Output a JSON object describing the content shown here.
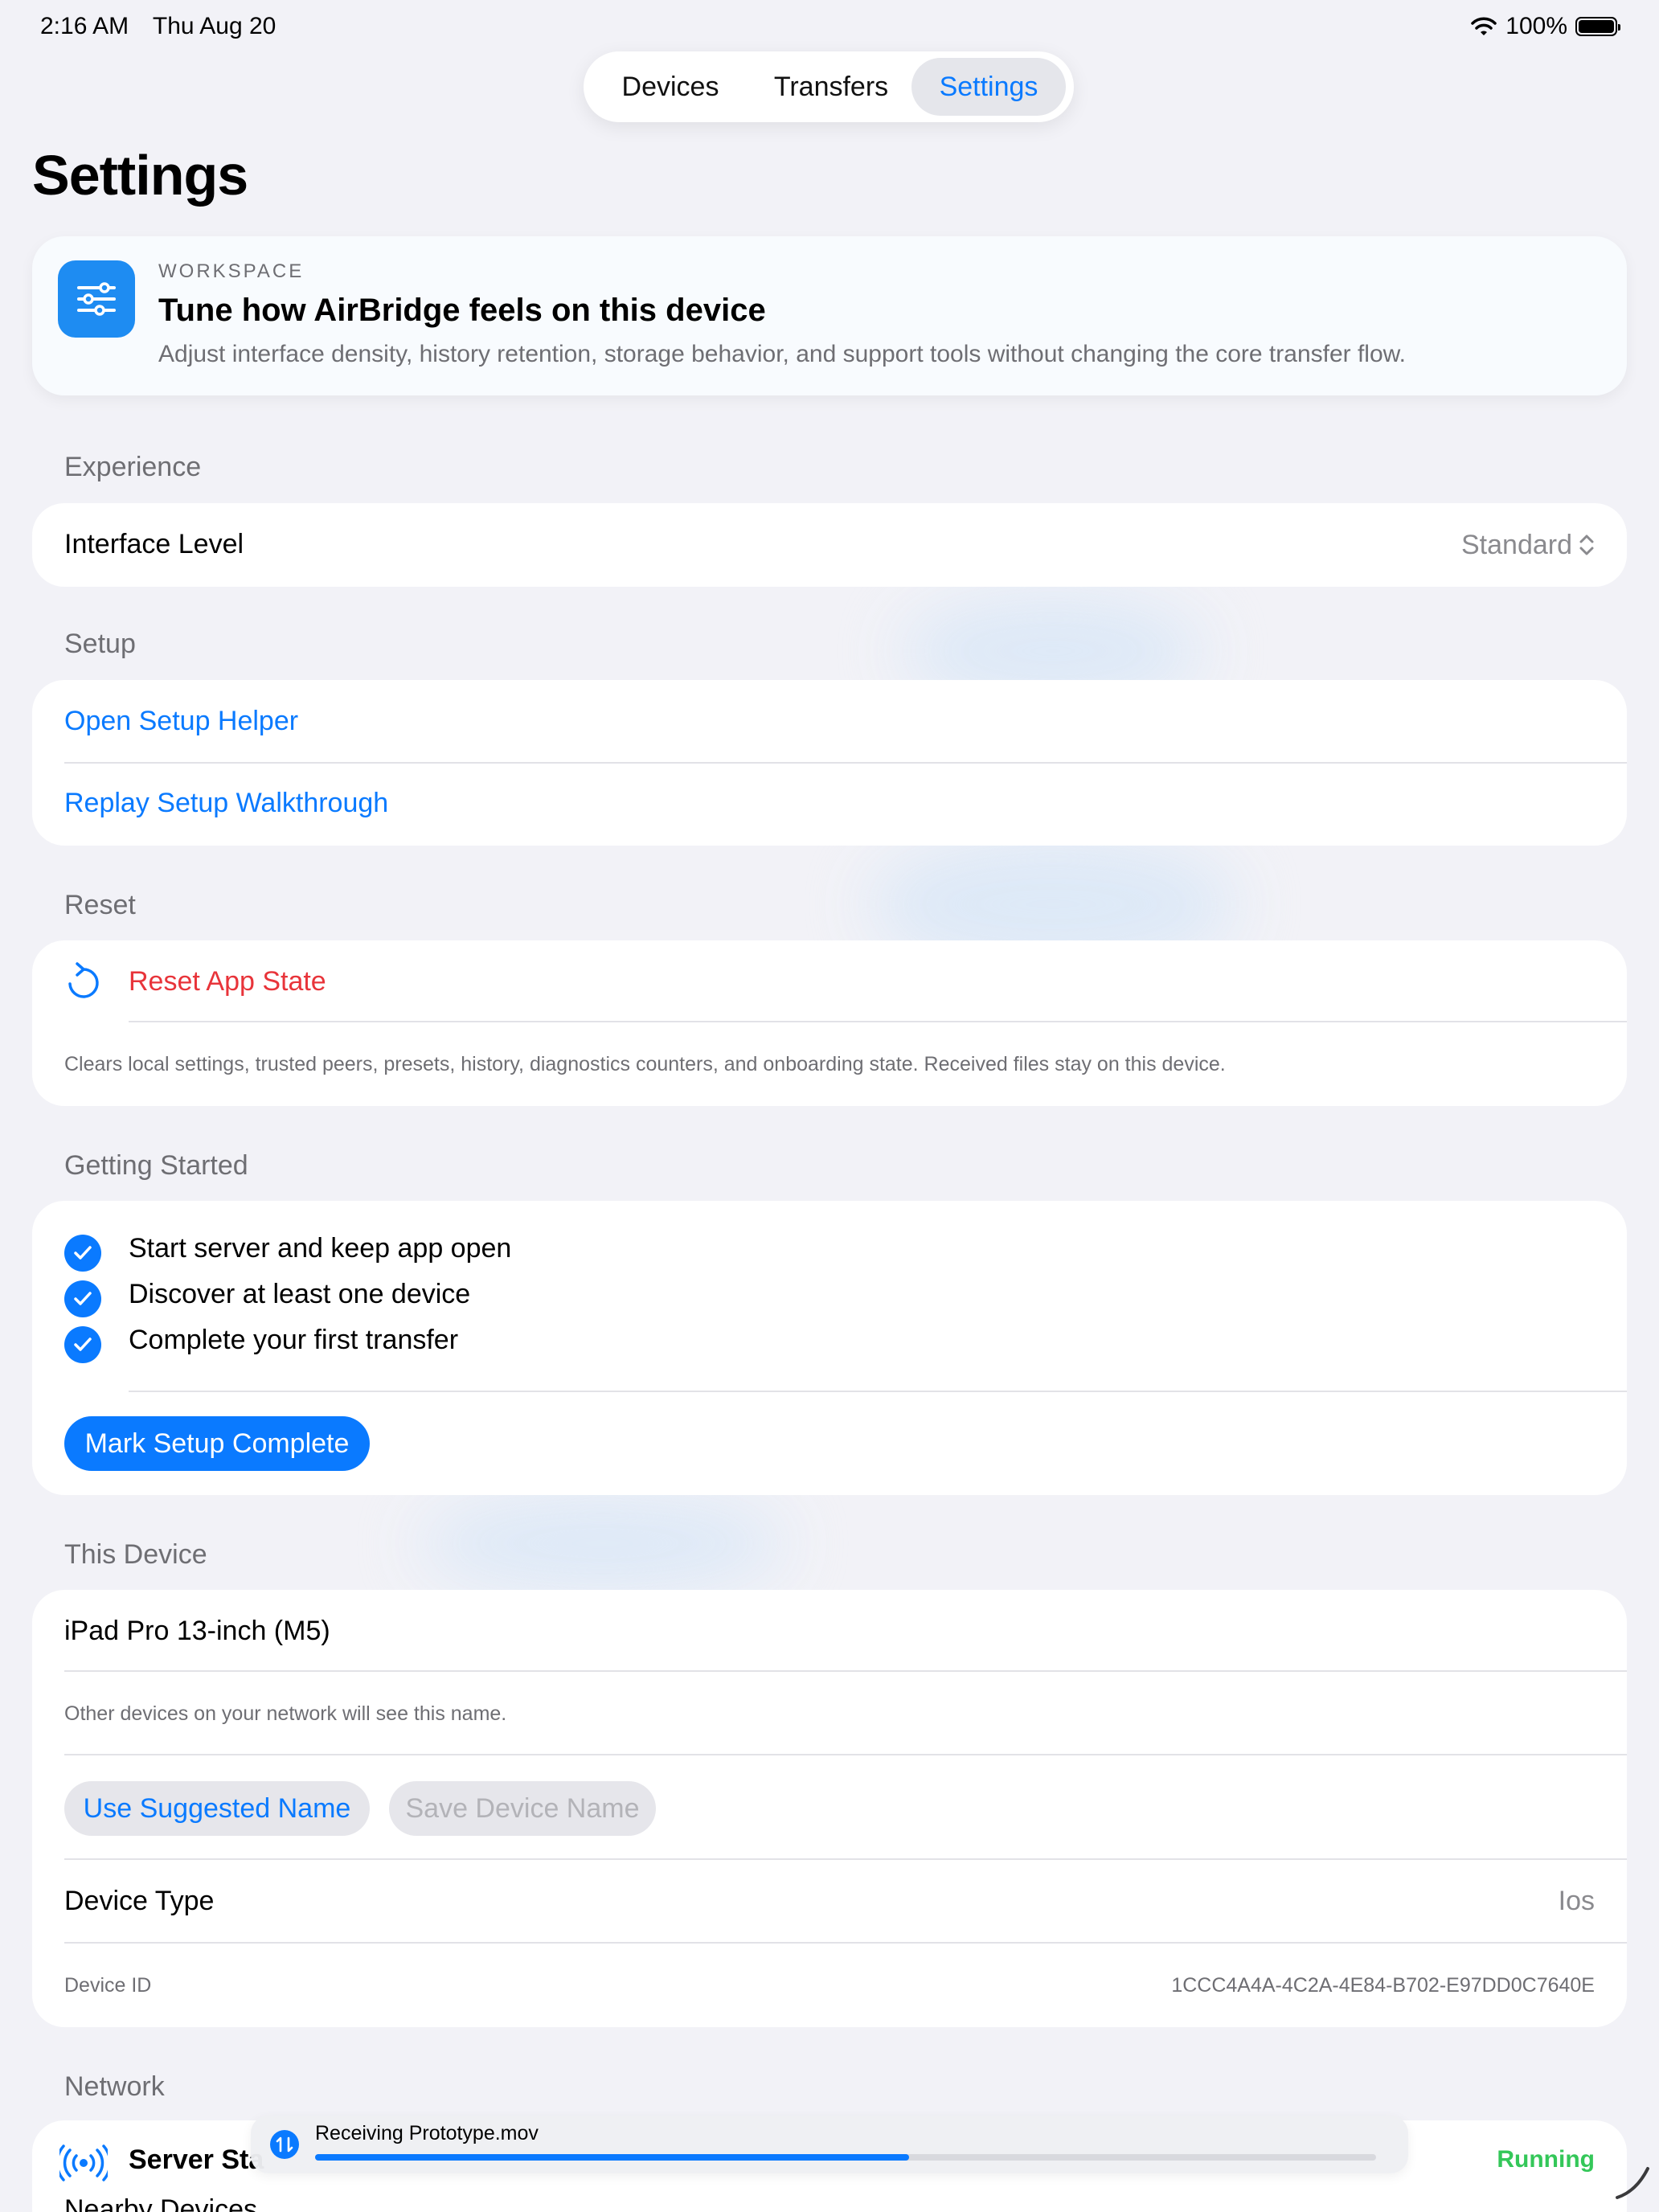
{
  "status_bar": {
    "time": "2:16 AM",
    "date": "Thu Aug 20",
    "battery": "100%"
  },
  "tabs": [
    "Devices",
    "Transfers",
    "Settings"
  ],
  "page_title": "Settings",
  "workspace": {
    "kicker": "WORKSPACE",
    "title": "Tune how AirBridge feels on this device",
    "description": "Adjust interface density, history retention, storage behavior, and support tools without changing the core transfer flow."
  },
  "experience": {
    "header": "Experience",
    "interface_level_label": "Interface Level",
    "interface_level_value": "Standard"
  },
  "setup": {
    "header": "Setup",
    "open_helper": "Open Setup Helper",
    "replay_walkthrough": "Replay Setup Walkthrough"
  },
  "reset": {
    "header": "Reset",
    "label": "Reset App State",
    "footnote": "Clears local settings, trusted peers, presets, history, diagnostics counters, and onboarding state. Received files stay on this device."
  },
  "getting_started": {
    "header": "Getting Started",
    "items": [
      "Start server and keep app open",
      "Discover at least one device",
      "Complete your first transfer"
    ],
    "button": "Mark Setup Complete"
  },
  "this_device": {
    "header": "This Device",
    "name": "iPad Pro 13-inch (M5)",
    "name_hint": "Other devices on your network will see this name.",
    "suggested_button": "Use Suggested Name",
    "save_button": "Save Device Name",
    "type_label": "Device Type",
    "type_value": "Ios",
    "id_label": "Device ID",
    "id_value": "1CCC4A4A-4C2A-4E84-B702-E97DD0C7640E"
  },
  "network": {
    "header": "Network",
    "server_status_label": "Server Sta",
    "server_status_value": "Running",
    "nearby_label": "Nearby Devices"
  },
  "transfer_toast": {
    "text": "Receiving Prototype.mov",
    "progress": 0.56
  },
  "colors": {
    "accent": "#0a7aff",
    "destructive": "#e8343a",
    "success": "#34c759",
    "background": "#f2f2f7"
  }
}
